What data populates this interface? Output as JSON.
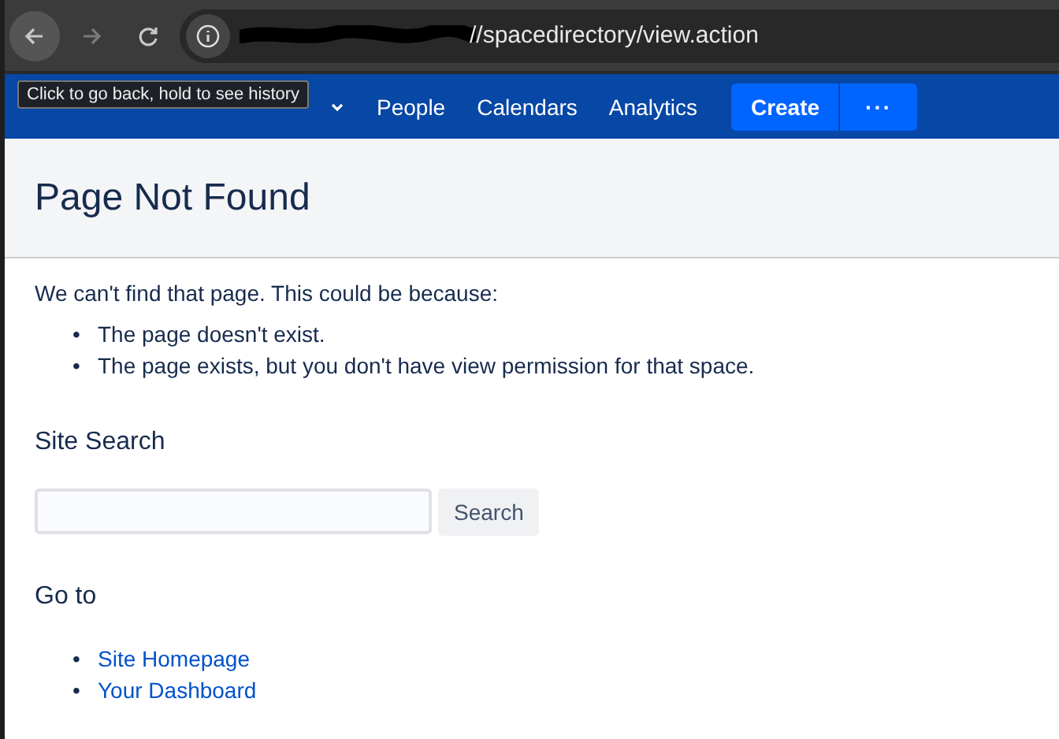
{
  "browser": {
    "url": "//spacedirectory/view.action",
    "tooltip": "Click to go back, hold to see history"
  },
  "nav": {
    "items": [
      {
        "kind": "dropdown"
      },
      {
        "label": "People",
        "kind": "link"
      },
      {
        "label": "Calendars",
        "kind": "link"
      },
      {
        "label": "Analytics",
        "kind": "link"
      }
    ],
    "create": "Create",
    "more": "···"
  },
  "page": {
    "title": "Page Not Found",
    "intro": "We can't find that page. This could be because:",
    "bullet": "•",
    "reasons": [
      "The page doesn't exist.",
      "The page exists, but you don't have view permission for that space."
    ]
  },
  "search": {
    "heading": "Site Search",
    "button": "Search"
  },
  "goto": {
    "heading": "Go to",
    "links": [
      "Site Homepage",
      "Your Dashboard"
    ]
  }
}
